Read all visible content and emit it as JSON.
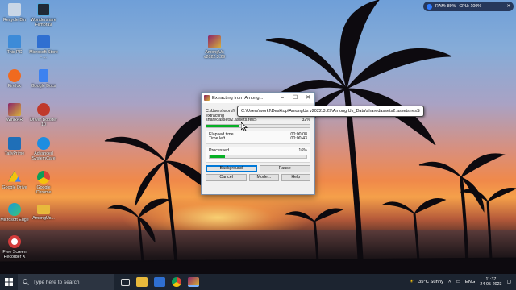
{
  "desktop_icons": [
    {
      "label": "Recycle Bin",
      "icon": "recycle-bin-icon",
      "color": "#c9d6e6"
    },
    {
      "label": "Wondershare Filmora9",
      "icon": "filmora-icon",
      "color": "#1f2a36"
    },
    {
      "label": "This PC",
      "icon": "computer-icon",
      "color": "#3d8bd8"
    },
    {
      "label": "Microsoft Store - ...",
      "icon": "store-icon",
      "color": "#2f6fd1"
    },
    {
      "label": "Firefox",
      "icon": "firefox-icon",
      "color": "#f06a1f"
    },
    {
      "label": "Google Docs",
      "icon": "docs-icon",
      "color": "#3d82f0"
    },
    {
      "label": "WinRAR",
      "icon": "winrar-icon",
      "color": "#8c2467"
    },
    {
      "label": "Driver Booster 10",
      "icon": "driver-booster-icon",
      "color": "#c0392b"
    },
    {
      "label": "TallyPrime",
      "icon": "tally-icon",
      "color": "#1f6fb8"
    },
    {
      "label": "Advanced SystemCare",
      "icon": "systemcare-icon",
      "color": "#1e8de0"
    },
    {
      "label": "Google Drive",
      "icon": "drive-icon",
      "color": "#f4c20d"
    },
    {
      "label": "Google Chrome",
      "icon": "chrome-icon",
      "color": "#db4437"
    },
    {
      "label": "Microsoft Edge",
      "icon": "edge-icon",
      "color": "#1c9ad6"
    },
    {
      "label": "AmongUs...",
      "icon": "folder-icon",
      "color": "#e8b93c"
    },
    {
      "label": "Free Screen Recorder X",
      "icon": "recorder-icon",
      "color": "#d33b3b"
    },
    {
      "label": "AmongUs v2022.3.29",
      "icon": "winrar-archive-icon",
      "color": "#8c2467"
    }
  ],
  "sysmon": {
    "ram": "RAM: 89%",
    "cpu": "CPU: 100%"
  },
  "extract_window": {
    "title": "Extracting from Among...",
    "path_prefix": "C:\\Users\\workf\\",
    "action": "extracting",
    "file": "sharedassets2.assets.resS",
    "file_percent": "32%",
    "file_progress": 0.32,
    "elapsed_label": "Elapsed time",
    "elapsed_value": "00:00:08",
    "left_label": "Time left",
    "left_value": "00:00:43",
    "processed_label": "Processed",
    "processed_percent": "16%",
    "processed_progress": 0.16,
    "buttons": {
      "background": "Background",
      "pause": "Pause",
      "cancel": "Cancel",
      "mode": "Mode...",
      "help": "Help"
    }
  },
  "tooltip": "C:\\Users\\workf\\Desktop\\AmongUs v2022.3.29\\Among Us_Data\\sharedassets2.assets.resS",
  "taskbar": {
    "search_placeholder": "Type here to search",
    "weather": "35°C  Sunny",
    "lang": "ENG",
    "time": "11:37",
    "date": "24-05-2023"
  },
  "colors": {
    "progress": "#06b025",
    "taskbar": "#1c2430",
    "accent": "#0078d7"
  }
}
